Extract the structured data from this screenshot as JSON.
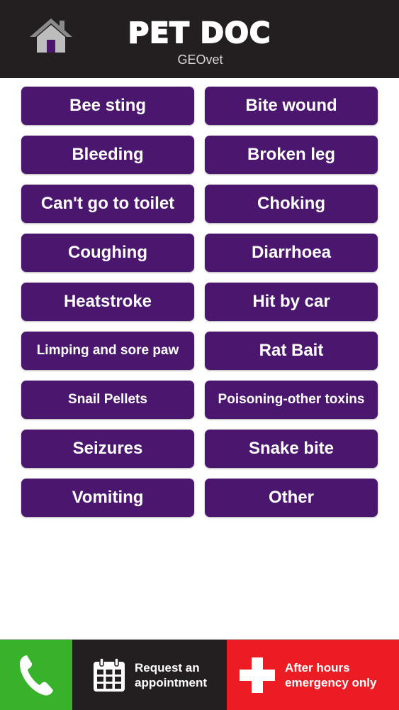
{
  "header": {
    "title": "PET DOC",
    "subtitle": "GEOvet",
    "home_icon": "home-icon"
  },
  "symptoms": [
    {
      "label": "Bee sting"
    },
    {
      "label": "Bite wound"
    },
    {
      "label": "Bleeding"
    },
    {
      "label": "Broken leg"
    },
    {
      "label": "Can't go to toilet"
    },
    {
      "label": "Choking"
    },
    {
      "label": "Coughing"
    },
    {
      "label": "Diarrhoea"
    },
    {
      "label": "Heatstroke"
    },
    {
      "label": "Hit by car"
    },
    {
      "label": "Limping and sore paw"
    },
    {
      "label": "Rat Bait"
    },
    {
      "label": "Snail Pellets"
    },
    {
      "label": "Poisoning-other toxins"
    },
    {
      "label": "Seizures"
    },
    {
      "label": "Snake bite"
    },
    {
      "label": "Vomiting"
    },
    {
      "label": "Other"
    }
  ],
  "footer": {
    "call_icon": "phone-icon",
    "appointment_label": "Request an\nappointment",
    "appointment_icon": "calendar-icon",
    "emergency_label": "After hours\nemergency only",
    "emergency_icon": "medical-cross-icon"
  },
  "colors": {
    "header_bg": "#231f20",
    "button_purple": "#4b176e",
    "call_green": "#39b22b",
    "emergency_red": "#ec1c24"
  }
}
